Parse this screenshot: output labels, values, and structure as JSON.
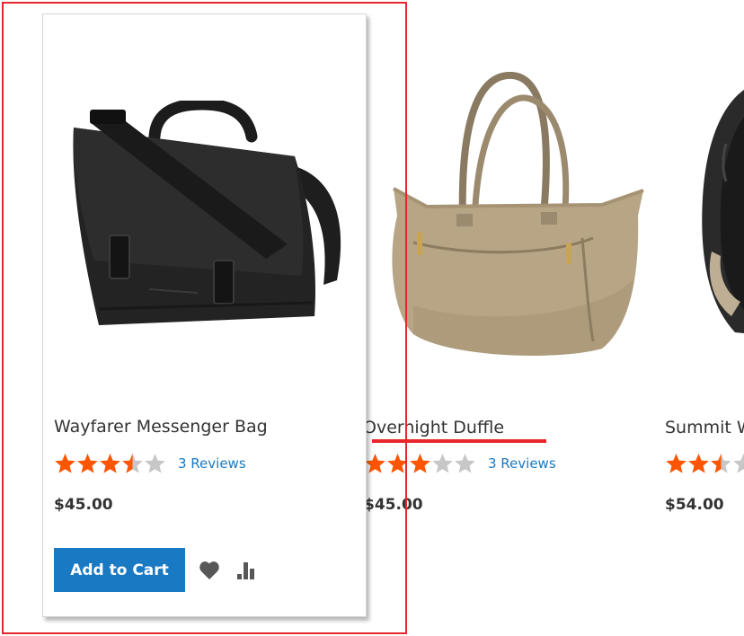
{
  "products": [
    {
      "name": "Wayfarer Messenger Bag",
      "rating": 3.5,
      "reviews_label": "3 Reviews",
      "price": "$45.00",
      "image_icon": "messenger-bag-image",
      "add_to_cart_label": "Add to Cart"
    },
    {
      "name": "Overnight Duffle",
      "rating": 3,
      "reviews_label": "3 Reviews",
      "price": "$45.00",
      "image_icon": "duffle-bag-image"
    },
    {
      "name": "Summit W",
      "rating": 2.5,
      "price": "$54.00",
      "image_icon": "backpack-image"
    }
  ],
  "icons": {
    "wishlist": "heart-icon",
    "compare": "compare-bars-icon"
  },
  "colors": {
    "accent": "#1979c3",
    "star_filled": "#ff5501",
    "star_empty": "#c7c7c7",
    "annotation": "#e8262b"
  }
}
